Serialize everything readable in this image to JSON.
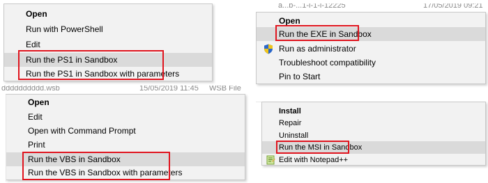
{
  "ps1_menu": {
    "items": [
      {
        "label": "Open",
        "bold": true
      },
      {
        "label": "Run with PowerShell"
      },
      {
        "label": "Edit"
      },
      {
        "label": "Run the PS1 in Sandbox",
        "highlighted": true
      },
      {
        "label": "Run the PS1 in Sandbox with parameters"
      }
    ]
  },
  "exe_menu": {
    "background_text": "a...b-...1-l-1-l-12225",
    "background_date": "17/05/2019 09:21",
    "items": [
      {
        "label": "Open",
        "bold": true
      },
      {
        "label": "Run the EXE in Sandbox",
        "highlighted": true
      },
      {
        "label": "Run as administrator",
        "icon": "uac-shield-icon"
      },
      {
        "label": "Troubleshoot compatibility"
      },
      {
        "label": "Pin to Start"
      }
    ]
  },
  "vbs_menu": {
    "background_filename": "dddddddddd.wsb",
    "background_date": "15/05/2019 11:45",
    "background_type": "WSB File",
    "items": [
      {
        "label": "Open",
        "bold": true
      },
      {
        "label": "Edit"
      },
      {
        "label": "Open with Command Prompt"
      },
      {
        "label": "Print"
      },
      {
        "label": "Run the VBS in Sandbox",
        "highlighted": true
      },
      {
        "label": "Run the VBS in Sandbox with parameters"
      }
    ]
  },
  "msi_menu": {
    "items": [
      {
        "label": "Install",
        "bold": true
      },
      {
        "label": "Repair"
      },
      {
        "label": "Uninstall"
      },
      {
        "label": "Run the MSI in Sandbox",
        "highlighted": true
      },
      {
        "label": "Edit with Notepad++",
        "icon": "notepad-plus-plus-icon"
      }
    ]
  },
  "colors": {
    "menu_background": "#f2f2f2",
    "highlight": "#dadada",
    "annotation_box": "#e0141e"
  }
}
